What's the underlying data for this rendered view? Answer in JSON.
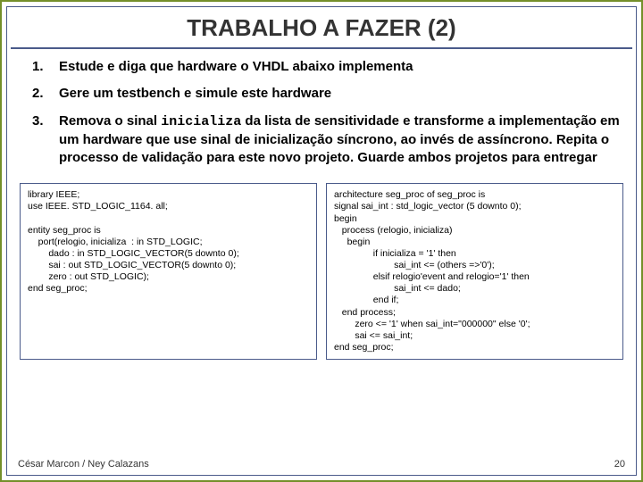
{
  "title": "TRABALHO A FAZER (2)",
  "items": {
    "n1": "1.",
    "t1": "Estude e diga que hardware o VHDL abaixo implementa",
    "n2": "2.",
    "t2": "Gere um testbench e simule este hardware",
    "n3": "3.",
    "t3a": "Remova o sinal ",
    "t3code": "inicializa",
    "t3b": " da lista de sensitividade e transforme a implementação em um hardware que use sinal de inicialização síncrono, ao invés de assíncrono. Repita o processo de validação para este novo projeto. Guarde ambos projetos para entregar"
  },
  "code_left": "library IEEE;\nuse IEEE. STD_LOGIC_1164. all;\n\nentity seg_proc is\n    port(relogio, inicializa  : in STD_LOGIC;\n        dado : in STD_LOGIC_VECTOR(5 downto 0);\n        sai : out STD_LOGIC_VECTOR(5 downto 0);\n        zero : out STD_LOGIC);\nend seg_proc;",
  "code_right": "architecture seg_proc of seg_proc is\nsignal sai_int : std_logic_vector (5 downto 0);\nbegin\n   process (relogio, inicializa)\n     begin\n               if inicializa = '1' then\n                       sai_int <= (others =>'0');\n               elsif relogio'event and relogio='1' then\n                       sai_int <= dado;\n               end if;\n   end process;\n        zero <= '1' when sai_int=\"000000\" else '0';\n        sai <= sai_int;\nend seg_proc;",
  "footer_left": "César Marcon / Ney Calazans",
  "footer_right": "20"
}
